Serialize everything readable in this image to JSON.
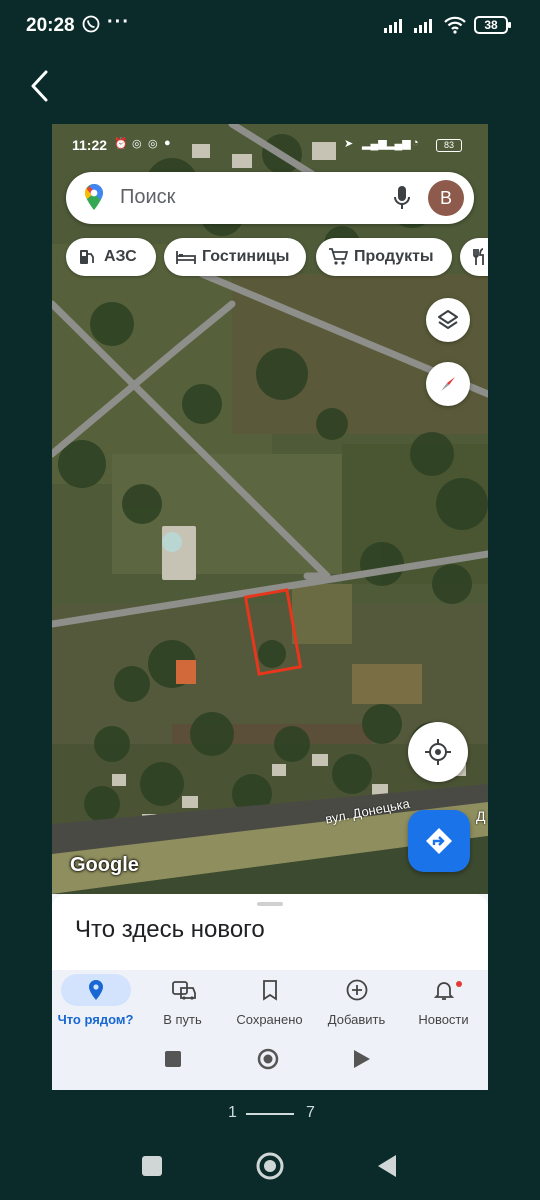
{
  "status_bar": {
    "time": "20:28",
    "battery": "38"
  },
  "phone": {
    "status_bar": {
      "time": "11:22",
      "battery": "83"
    },
    "search": {
      "placeholder": "Поиск",
      "avatar_letter": "B"
    },
    "chips": [
      {
        "label": "АЗС",
        "icon": "gas-station-icon"
      },
      {
        "label": "Гостиницы",
        "icon": "bed-icon"
      },
      {
        "label": "Продукты",
        "icon": "cart-icon"
      },
      {
        "label": "",
        "icon": "restaurant-icon"
      }
    ],
    "map": {
      "watermark": "Google",
      "street_label": "вул. Донецька",
      "street_label_cut": "Д",
      "parcel_color": "#e8361c"
    },
    "sheet": {
      "title": "Что здесь нового"
    },
    "nav": [
      {
        "label": "Что рядом?",
        "icon": "location-pin-icon",
        "active": true
      },
      {
        "label": "В путь",
        "icon": "commute-icon"
      },
      {
        "label": "Сохранено",
        "icon": "bookmark-icon"
      },
      {
        "label": "Добавить",
        "icon": "add-circle-icon"
      },
      {
        "label": "Новости",
        "icon": "bell-icon",
        "badge": true
      }
    ]
  },
  "pager": {
    "current": "1",
    "total": "7"
  },
  "colors": {
    "accent": "#1a73e8",
    "background": "#0b2a2a"
  }
}
